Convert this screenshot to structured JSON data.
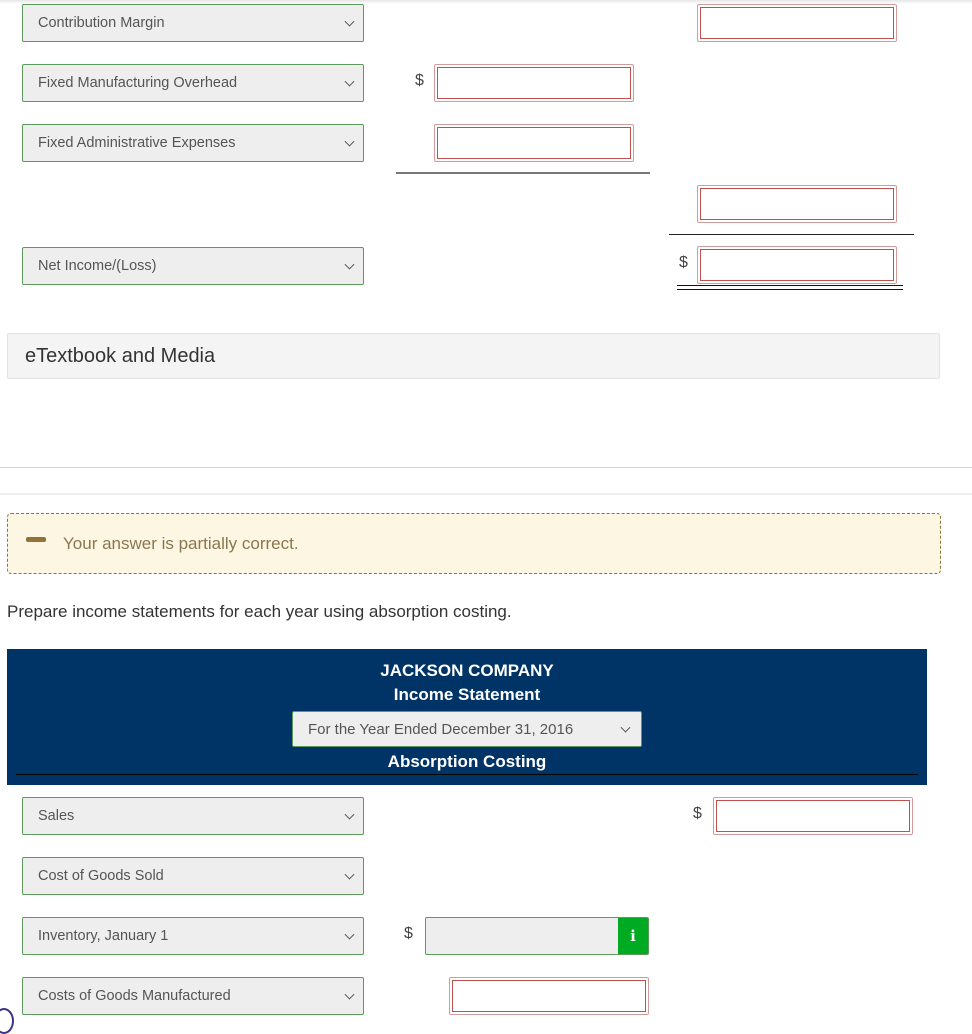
{
  "variable_costing_section": {
    "rows": [
      {
        "label": "Contribution Margin"
      },
      {
        "label": "Fixed Manufacturing Overhead",
        "inner_currency": "$"
      },
      {
        "label": "Fixed Administrative Expenses"
      },
      {
        "label": "Net Income/(Loss)",
        "outer_currency": "$"
      }
    ],
    "inputs": {
      "contribution_margin_total": "",
      "fixed_manufacturing_overhead": "",
      "fixed_administrative_expenses": "",
      "total_fixed_costs": "",
      "net_income_loss": ""
    }
  },
  "etextbook": {
    "label": "eTextbook and Media"
  },
  "feedback": {
    "message": "Your answer is partially correct.",
    "status": "partial",
    "color": "#8f7338"
  },
  "prompt": {
    "text": "Prepare income statements for each year using absorption costing."
  },
  "statement_header": {
    "company": "JACKSON COMPANY",
    "title": "Income Statement",
    "period_selected": "For the Year Ended December 31, 2016",
    "method": "Absorption Costing",
    "background_color": "#003366"
  },
  "absorption_section": {
    "rows": [
      {
        "label": "Sales",
        "currency": "$",
        "value": ""
      },
      {
        "label": "Cost of Goods Sold"
      },
      {
        "label": "Inventory, January 1",
        "currency": "$",
        "value": "",
        "info_icon": "i"
      },
      {
        "label": "Costs of Goods Manufactured",
        "value": ""
      }
    ]
  }
}
